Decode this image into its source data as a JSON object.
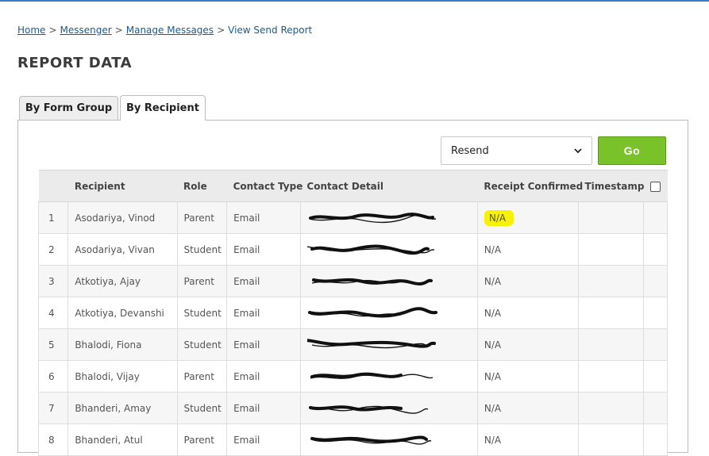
{
  "breadcrumb": {
    "home": "Home",
    "sep": ">",
    "messenger": "Messenger",
    "manage": "Manage Messages",
    "current": "View Send Report"
  },
  "page": {
    "title": "REPORT DATA"
  },
  "tabs": [
    {
      "label": "By Form Group",
      "active": false
    },
    {
      "label": "By Recipient",
      "active": true
    }
  ],
  "toolbar": {
    "select_value": "Resend",
    "go_label": "Go",
    "go_color": "#79c22a"
  },
  "table": {
    "headers": [
      "",
      "Recipient",
      "Role",
      "Contact Type",
      "Contact Detail",
      "Receipt Confirmed",
      "Timestamp",
      ""
    ],
    "rows": [
      {
        "num": "1",
        "recipient": "Asodariya, Vinod",
        "role": "Parent",
        "type": "Email",
        "receipt": "N/A",
        "highlight": true
      },
      {
        "num": "2",
        "recipient": "Asodariya, Vivan",
        "role": "Student",
        "type": "Email",
        "receipt": "N/A"
      },
      {
        "num": "3",
        "recipient": "Atkotiya, Ajay",
        "role": "Parent",
        "type": "Email",
        "receipt": "N/A"
      },
      {
        "num": "4",
        "recipient": "Atkotiya, Devanshi",
        "role": "Student",
        "type": "Email",
        "receipt": "N/A"
      },
      {
        "num": "5",
        "recipient": "Bhalodi, Fiona",
        "role": "Student",
        "type": "Email",
        "receipt": "N/A"
      },
      {
        "num": "6",
        "recipient": "Bhalodi, Vijay",
        "role": "Parent",
        "type": "Email",
        "receipt": "N/A"
      },
      {
        "num": "7",
        "recipient": "Bhanderi, Amay",
        "role": "Student",
        "type": "Email",
        "receipt": "N/A"
      },
      {
        "num": "8",
        "recipient": "Bhanderi, Atul",
        "role": "Parent",
        "type": "Email",
        "receipt": "N/A"
      }
    ]
  },
  "colors": {
    "highlight": "#f6f200",
    "link": "#1d5a8a"
  }
}
